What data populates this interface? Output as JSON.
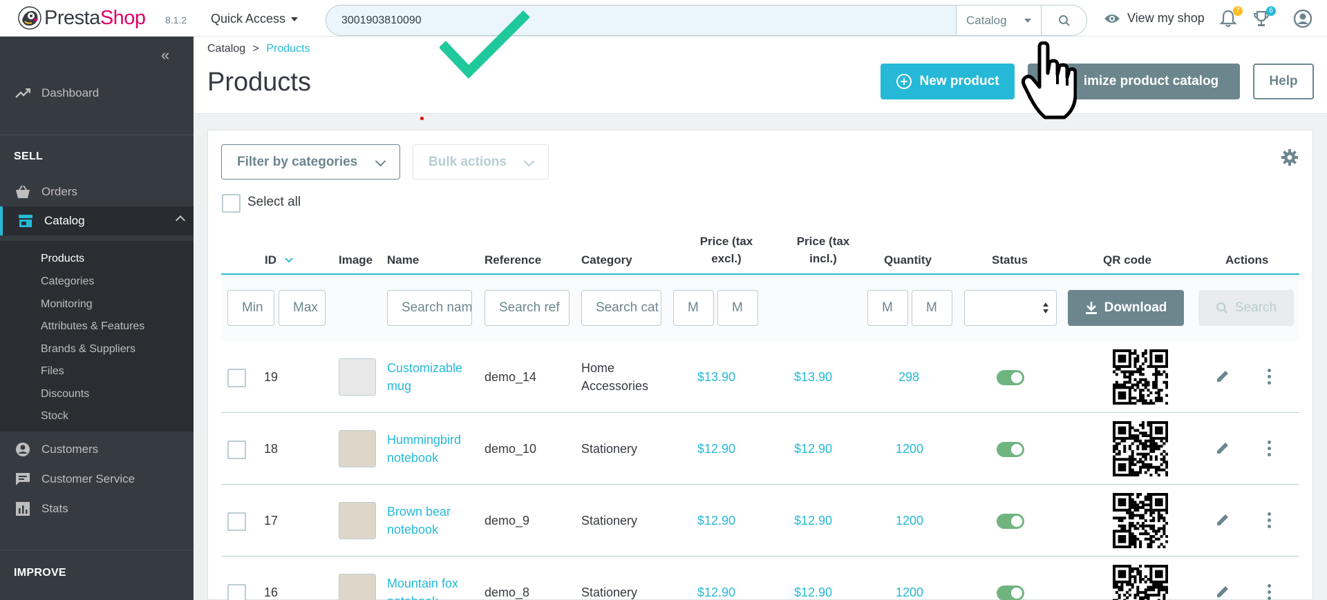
{
  "topbar": {
    "brand_pre": "Presta",
    "brand_post": "Shop",
    "version": "8.1.2",
    "quick_access": "Quick Access",
    "search_value": "3001903810090",
    "search_scope": "Catalog",
    "view_shop": "View my shop",
    "notif_count_1": "7",
    "notif_count_2": "6",
    "badge_color_1": "#fbbb22",
    "badge_color_2": "#25b9d7"
  },
  "sidebar": {
    "dashboard": "Dashboard",
    "sell_section": "SELL",
    "orders": "Orders",
    "catalog": "Catalog",
    "submenu": [
      "Products",
      "Categories",
      "Monitoring",
      "Attributes & Features",
      "Brands & Suppliers",
      "Files",
      "Discounts",
      "Stock"
    ],
    "customers": "Customers",
    "customer_service": "Customer Service",
    "stats": "Stats",
    "improve_section": "IMPROVE"
  },
  "header": {
    "breadcrumb_parent": "Catalog",
    "breadcrumb_sep": ">",
    "breadcrumb_current": "Products",
    "title": "Products",
    "new_product": "New product",
    "optimize": "imize product catalog",
    "help": "Help"
  },
  "toolbar": {
    "filter_categories": "Filter by categories",
    "bulk_actions": "Bulk actions",
    "select_all": "Select all"
  },
  "columns": {
    "id": "ID",
    "image": "Image",
    "name": "Name",
    "reference": "Reference",
    "category": "Category",
    "price_excl_1": "Price (tax",
    "price_excl_2": "excl.)",
    "price_incl_1": "Price (tax",
    "price_incl_2": "incl.)",
    "quantity": "Quantity",
    "status": "Status",
    "qr": "QR code",
    "actions": "Actions"
  },
  "filters": {
    "id_min": "Min",
    "id_max": "Max",
    "name": "Search name",
    "reference": "Search ref",
    "category": "Search cat",
    "price_min": "M",
    "price_max": "M",
    "qty_min": "M",
    "qty_max": "M",
    "download": "Download",
    "search": "Search"
  },
  "products": [
    {
      "id": "19",
      "name_1": "Customizable",
      "name_2": "mug",
      "reference": "demo_14",
      "category_1": "Home",
      "category_2": "Accessories",
      "price_excl": "$13.90",
      "price_incl": "$13.90",
      "quantity": "298",
      "status": true
    },
    {
      "id": "18",
      "name_1": "Hummingbird",
      "name_2": "notebook",
      "reference": "demo_10",
      "category_1": "Stationery",
      "category_2": "",
      "price_excl": "$12.90",
      "price_incl": "$12.90",
      "quantity": "1200",
      "status": true
    },
    {
      "id": "17",
      "name_1": "Brown bear",
      "name_2": "notebook",
      "reference": "demo_9",
      "category_1": "Stationery",
      "category_2": "",
      "price_excl": "$12.90",
      "price_incl": "$12.90",
      "quantity": "1200",
      "status": true
    },
    {
      "id": "16",
      "name_1": "Mountain fox",
      "name_2": "notebook",
      "reference": "demo_8",
      "category_1": "Stationery",
      "category_2": "",
      "price_excl": "$12.90",
      "price_incl": "$12.90",
      "quantity": "1200",
      "status": true
    }
  ]
}
